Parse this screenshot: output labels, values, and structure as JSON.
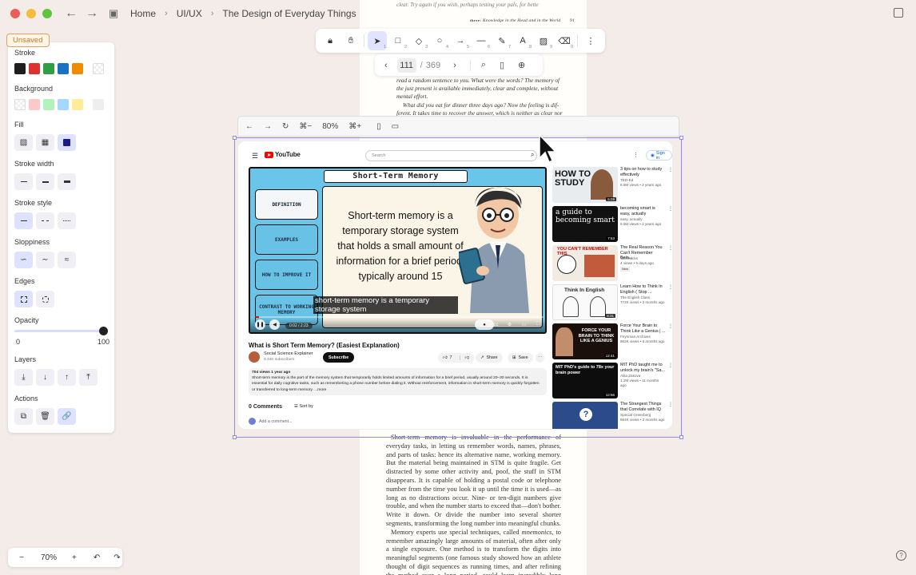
{
  "window": {
    "breadcrumb": [
      "Home",
      "UI/UX",
      "The Design of Everyday Things"
    ]
  },
  "status": {
    "unsaved": "Unsaved"
  },
  "properties": {
    "stroke_label": "Stroke",
    "stroke_colors": [
      "#1e1e1e",
      "#e03131",
      "#2f9e44",
      "#1971c2",
      "#f08c00"
    ],
    "background_label": "Background",
    "background_colors": [
      "#ffc9c9",
      "#b2f2bb",
      "#a5d8ff",
      "#ffec99"
    ],
    "fill_label": "Fill",
    "stroke_width_label": "Stroke width",
    "stroke_style_label": "Stroke style",
    "sloppiness_label": "Sloppiness",
    "edges_label": "Edges",
    "opacity_label": "Opacity",
    "opacity_min": "0",
    "opacity_max": "100",
    "opacity_value": 100,
    "layers_label": "Layers",
    "actions_label": "Actions"
  },
  "drawing_toolbar": {
    "tools": [
      {
        "icon": "lock-icon",
        "key": ""
      },
      {
        "icon": "hand-icon",
        "key": ""
      },
      {
        "icon": "selection-icon",
        "key": "1"
      },
      {
        "icon": "rectangle-icon",
        "key": "2"
      },
      {
        "icon": "diamond-icon",
        "key": "3"
      },
      {
        "icon": "ellipse-icon",
        "key": "4"
      },
      {
        "icon": "arrow-icon",
        "key": "5"
      },
      {
        "icon": "line-icon",
        "key": "6"
      },
      {
        "icon": "pencil-icon",
        "key": "7"
      },
      {
        "icon": "text-icon",
        "key": "8"
      },
      {
        "icon": "image-icon",
        "key": "9"
      },
      {
        "icon": "eraser-icon",
        "key": "0"
      }
    ]
  },
  "page_nav": {
    "current": "111",
    "separator": "/",
    "total": "369"
  },
  "embed_toolbar": {
    "zoom": "80%",
    "shortcut1": "⌘−",
    "shortcut2": "⌘+"
  },
  "pdf": {
    "first_top": "clear. Try again if you wish, perhaps testing your pals, for bette",
    "header_chapter": "three:",
    "header_title": "Knowledge in the Head and in the World",
    "header_page": "91",
    "top_paragraph": "read a random sentence to you. What were the words? The memory of the just present is available immediately, clear and complete, without mental effort.",
    "top_paragraph2": "What did you eat for dinner three days ago? Now the feeling is dif-ferent. It takes time to recover the answer, which is neither as clear nor",
    "bottom_p1": "Short-term memory is invaluable in the performance of everyday tasks, in letting us remember words, names, phrases, and parts of tasks: hence its alternative name, working memory. But the material being maintained in STM is quite fragile. Get distracted by some other activity and, poof, the stuff in STM disappears. It is capable of holding a postal code or telephone number from the time you look it up until the time it is used—as long as no distractions occur. Nine- or ten-digit numbers give trouble, and when the number starts to exceed that—don't bother. Write it down. Or divide the number into several shorter segments, transforming the long number into meaningful chunks.",
    "bottom_p2_a": "Memory experts use special techniques, called ",
    "bottom_p2_em": "mnemonics",
    "bottom_p2_b": ", to remember amazingly large amounts of material, often after only a single exposure. One method is to transform the digits into meaningful segments (one famous study showed how an athlete thought of digit sequences as running times, and after refining the method over a long period, could learn incredibly long sequences at one glance). One traditional method used to encode"
  },
  "youtube": {
    "logo": "YouTube",
    "search_placeholder": "Search",
    "sign_in": "Sign in",
    "video": {
      "slide_title": "Short-Term Memory",
      "side_items": [
        "DEFINITION",
        "EXAMPLES",
        "HOW TO IMPROVE IT",
        "CONTRAST TO WORKING MEMORY"
      ],
      "main_text": "Short-term memory is a temporary storage system that holds a small amount of information for a brief period, typically around 15",
      "caption": "short-term memory is a temporary storage system",
      "time": "0:02 / 2:23",
      "progress": 0.015
    },
    "title": "What is Short Term Memory? (Easiest Explanation)",
    "channel": "Social Science Explainer",
    "subscribers": "9.34K subscribers",
    "subscribe": "Subscribe",
    "likes": "7",
    "share": "Share",
    "save": "Save",
    "views_meta": "704 views  1 year ago",
    "description": "Short-term memory is the part of the memory system that temporarily holds limited amounts of information for a brief period, usually around 20–30 seconds. It is essential for daily cognitive tasks, such as remembering a phone number before dialing it. Without reinforcement, information in short-term memory is quickly forgotten or transferred to long-term memory.",
    "more": "...more",
    "comments": "0 Comments",
    "sort_by": "Sort by",
    "add_comment": "Add a comment...",
    "recommendations": [
      {
        "title": "3 tips on how to study effectively",
        "channel": "TED-Ed",
        "meta": "8.5M views • 2 years ago",
        "duration": "5:09",
        "thumb_text": "HOW TO STUDY"
      },
      {
        "title": "becoming smart is easy, actually",
        "channel": "easy, actually",
        "meta": "9.5M views • 2 years ago",
        "duration": "7:53",
        "thumb_text": "a guide to becoming smart"
      },
      {
        "title": "The Real Reason You Can't Remember Bein...",
        "channel": "WizeMicks",
        "meta": "4 views • 5 days ago",
        "duration": "",
        "badge": "New",
        "thumb_text": "YOU CAN'T REMEMBER THIS"
      },
      {
        "title": "Learn How to Think In English ( Stop ...",
        "channel": "The English Class",
        "meta": "772K views • 2 months ago",
        "duration": "8:31",
        "thumb_text": "Think In English"
      },
      {
        "title": "Force Your Brain to Think Like a Genius | ...",
        "channel": "Feynman Archives",
        "meta": "862K views • 6 months ago",
        "duration": "12:41",
        "thumb_text": "FORCE YOUR BRAIN TO THINK LIKE A GENIUS"
      },
      {
        "title": "MIT PhD taught me to unlock my brain's \"Sa...",
        "channel": "Alita Zakova",
        "meta": "1.2M views • 11 months ago",
        "duration": "12:56",
        "thumb_text": "MIT PhD's guide to 78x your brain power"
      },
      {
        "title": "The Strangest Things that Correlate with IQ",
        "channel": "Special Greenberg",
        "meta": "864K views • 2 months ago",
        "duration": "",
        "thumb_text": "?"
      }
    ]
  },
  "zoom_controls": {
    "minus": "−",
    "value": "70%",
    "plus": "+"
  }
}
